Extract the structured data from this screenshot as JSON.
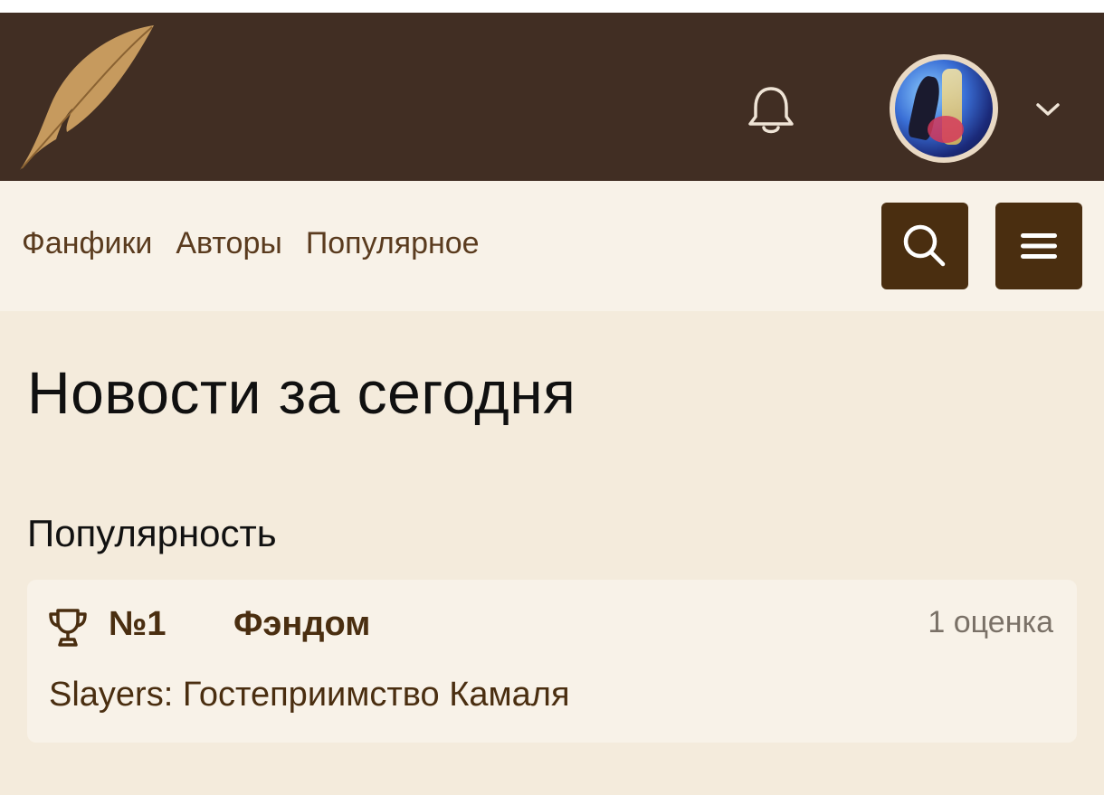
{
  "header": {
    "logo_icon": "feather-quill-icon",
    "bell_icon": "bell-icon",
    "avatar_alt": "user-avatar",
    "dropdown_icon": "chevron-down-icon",
    "colors": {
      "bg": "#412e23",
      "accent": "#c69a5e"
    }
  },
  "nav": {
    "links": [
      "Фанфики",
      "Авторы",
      "Популярное"
    ],
    "search_icon": "search-icon",
    "menu_icon": "hamburger-menu-icon",
    "colors": {
      "bg": "#f8f2e8",
      "button": "#4a2e10",
      "link": "#5a3b1e"
    }
  },
  "main": {
    "title": "Новости за сегодня",
    "section": "Популярность",
    "card": {
      "icon": "trophy-icon",
      "rank": "№1",
      "fandom_label": "Фэндом",
      "rating": "1 оценка",
      "work_title": "Slayers: Гостеприимство Камаля"
    },
    "colors": {
      "bg": "#f4ebdc",
      "card": "#f8f2e8"
    }
  }
}
